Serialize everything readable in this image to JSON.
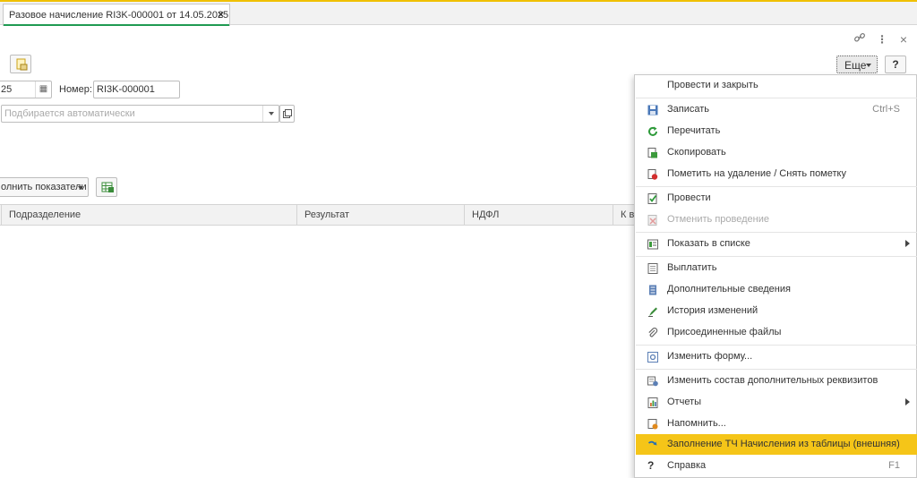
{
  "tab": {
    "title": "Разовое начисление RI3K-000001 от 14.05.2025",
    "close": "×"
  },
  "window_icons": {
    "link": "🔗",
    "more": "⋮",
    "close": "×"
  },
  "toolbar": {
    "more_label": "Еще",
    "help_label": "?"
  },
  "form": {
    "date_value": "25",
    "number_label": "Номер:",
    "number_value": "RI3K-000001",
    "auto_placeholder": "Подбирается автоматически",
    "fill_button_label": "олнить показатели"
  },
  "table": {
    "columns": [
      "Подразделение",
      "Результат",
      "НДФЛ",
      "К вы"
    ]
  },
  "menu": {
    "items": [
      {
        "label": "Провести и закрыть",
        "icon": "none"
      },
      {
        "label": "Записать",
        "icon": "save-icon",
        "shortcut": "Ctrl+S"
      },
      {
        "label": "Перечитать",
        "icon": "refresh-icon"
      },
      {
        "label": "Скопировать",
        "icon": "copy-icon"
      },
      {
        "label": "Пометить на удаление / Снять пометку",
        "icon": "delete-mark-icon"
      },
      {
        "label": "Провести",
        "icon": "post-icon"
      },
      {
        "label": "Отменить проведение",
        "icon": "unpost-icon",
        "disabled": true
      },
      {
        "label": "Показать в списке",
        "icon": "list-icon",
        "submenu": true
      },
      {
        "label": "Выплатить",
        "icon": "pay-icon"
      },
      {
        "label": "Дополнительные сведения",
        "icon": "info-icon"
      },
      {
        "label": "История изменений",
        "icon": "history-icon"
      },
      {
        "label": "Присоединенные файлы",
        "icon": "paperclip-icon"
      },
      {
        "label": "Изменить форму...",
        "icon": "form-icon"
      },
      {
        "label": "Изменить состав дополнительных реквизитов",
        "icon": "props-icon"
      },
      {
        "label": "Отчеты",
        "icon": "report-icon",
        "submenu": true
      },
      {
        "label": "Напомнить...",
        "icon": "reminder-icon"
      },
      {
        "label": "Заполнение ТЧ Начисления из таблицы (внешняя)",
        "icon": "arrow-icon",
        "highlight": true
      },
      {
        "label": "Справка",
        "icon": "help-icon",
        "shortcut": "F1"
      }
    ]
  },
  "colors": {
    "accent": "#f5c518",
    "tab_underline": "#1f9a52",
    "top_border": "#f0c000"
  }
}
